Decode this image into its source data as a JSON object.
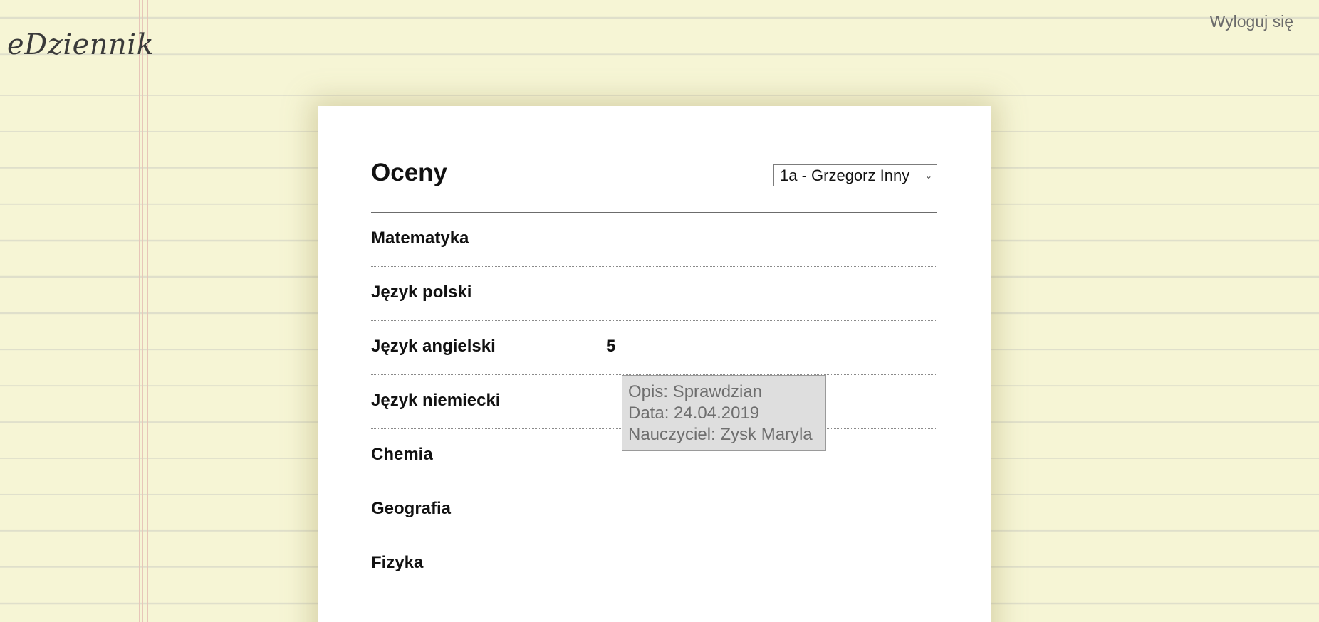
{
  "app": {
    "logo": "eDziennik",
    "logout_label": "Wyloguj się"
  },
  "page": {
    "title": "Oceny",
    "student_select": {
      "selected": "1a - Grzegorz Inny",
      "chevron_icon": "chevron-down-icon"
    }
  },
  "subjects": [
    {
      "name": "Matematyka",
      "grades": []
    },
    {
      "name": "Język polski",
      "grades": []
    },
    {
      "name": "Język angielski",
      "grades": [
        "5"
      ]
    },
    {
      "name": "Język niemiecki",
      "grades": []
    },
    {
      "name": "Chemia",
      "grades": []
    },
    {
      "name": "Geografia",
      "grades": []
    },
    {
      "name": "Fizyka",
      "grades": []
    }
  ],
  "tooltip": {
    "description": "Opis: Sprawdzian",
    "date": "Data: 24.04.2019",
    "teacher": "Nauczyciel: Zysk Maryla"
  },
  "colors": {
    "background": "#f6f5d5",
    "card": "#ffffff",
    "tooltip_bg": "#dedede",
    "text": "#111111"
  }
}
